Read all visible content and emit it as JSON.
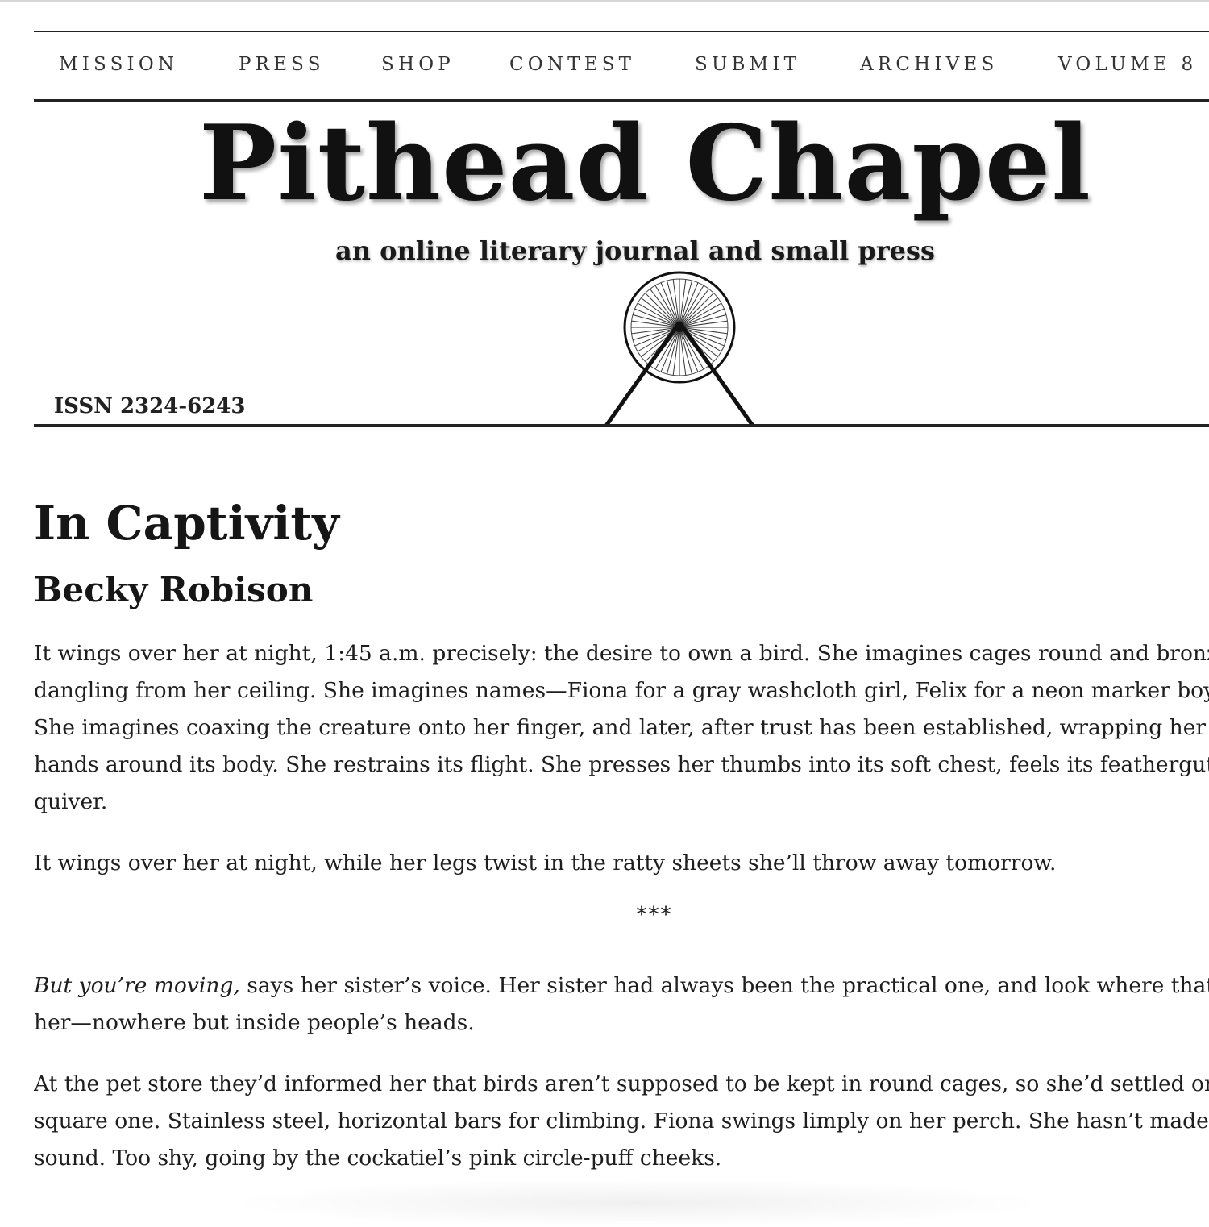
{
  "nav": {
    "items": [
      "MISSION",
      "PRESS",
      "SHOP",
      "CONTEST",
      "SUBMIT",
      "ARCHIVES",
      "VOLUME 8"
    ]
  },
  "banner": {
    "title": "Pithead Chapel",
    "tagline": "an online literary journal and small press",
    "issn": "ISSN 2324-6243",
    "logo_icon": "headframe-wheel-icon"
  },
  "article": {
    "title": "In Captivity",
    "author": "Becky Robison",
    "p1": [
      "It wings over her at night, 1:45 a.m. precisely: the desire to own a bird. She imagines cages round and bronze,",
      "dangling from her ceiling. She imagines names—Fiona for a gray washcloth girl, Felix for a neon marker boy.",
      "She imagines coaxing the creature onto her finger, and later, after trust has been established, wrapping her",
      "hands around its body. She restrains its flight. She presses her thumbs into its soft chest, feels its featherguts",
      "quiver."
    ],
    "p2": "It wings over her at night, while her legs twist in the ratty sheets she’ll throw away tomorrow.",
    "separator": "***",
    "p3_italic": "But you’re moving,",
    "p3_line1_rest": " says her sister’s voice. Her sister had always been the practical one, and look where that got",
    "p3_line2": "her—nowhere but inside people’s heads.",
    "p4": [
      "At the pet store they’d informed her that birds aren’t supposed to be kept in round cages, so she’d settled on a",
      "square one. Stainless steel, horizontal bars for climbing. Fiona swings limply on her perch. She hasn’t made a",
      "sound. Too shy, going by the cockatiel’s pink circle-puff cheeks."
    ]
  }
}
